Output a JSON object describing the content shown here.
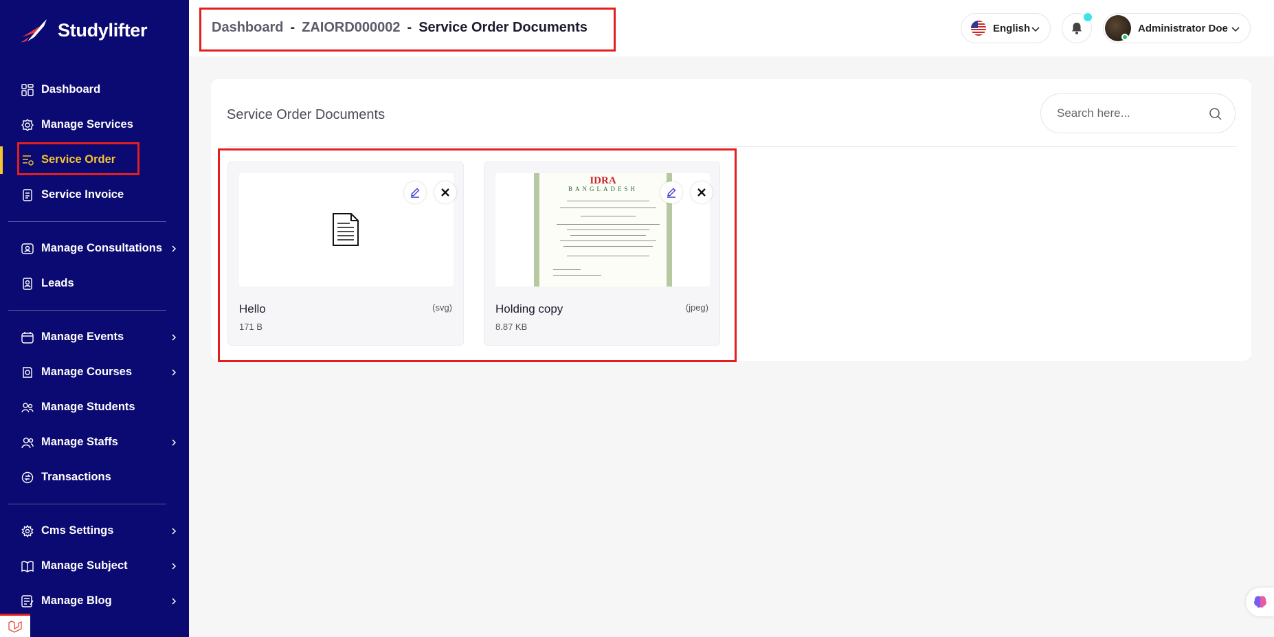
{
  "brand": {
    "name": "Studylifter"
  },
  "sidebar": {
    "groups": [
      [
        {
          "label": "Dashboard",
          "icon": "dashboard-icon",
          "chevron": false,
          "active": false
        },
        {
          "label": "Manage Services",
          "icon": "services-icon",
          "chevron": false,
          "active": false
        },
        {
          "label": "Service Order",
          "icon": "list-icon",
          "chevron": false,
          "active": true
        },
        {
          "label": "Service Invoice",
          "icon": "invoice-icon",
          "chevron": false,
          "active": false
        }
      ],
      [
        {
          "label": "Manage Consultations",
          "icon": "consultation-icon",
          "chevron": true,
          "active": false
        },
        {
          "label": "Leads",
          "icon": "leads-icon",
          "chevron": false,
          "active": false
        }
      ],
      [
        {
          "label": "Manage Events",
          "icon": "calendar-icon",
          "chevron": true,
          "active": false
        },
        {
          "label": "Manage Courses",
          "icon": "courses-icon",
          "chevron": true,
          "active": false
        },
        {
          "label": "Manage Students",
          "icon": "students-icon",
          "chevron": false,
          "active": false
        },
        {
          "label": "Manage Staffs",
          "icon": "staffs-icon",
          "chevron": true,
          "active": false
        },
        {
          "label": "Transactions",
          "icon": "transactions-icon",
          "chevron": false,
          "active": false
        }
      ],
      [
        {
          "label": "Cms Settings",
          "icon": "gear-icon",
          "chevron": true,
          "active": false
        },
        {
          "label": "Manage Subject",
          "icon": "book-icon",
          "chevron": true,
          "active": false
        },
        {
          "label": "Manage Blog",
          "icon": "blog-icon",
          "chevron": true,
          "active": false
        }
      ]
    ]
  },
  "header": {
    "breadcrumb": [
      "Dashboard",
      "ZAIORD000002",
      "Service Order Documents"
    ],
    "breadcrumb_separator": "-",
    "language": "English",
    "user_name": "Administrator Doe"
  },
  "main": {
    "title": "Service Order Documents",
    "search_placeholder": "Search here...",
    "documents": [
      {
        "name": "Hello",
        "ext": "(svg)",
        "size": "171 B",
        "preview": "file-icon"
      },
      {
        "name": "Holding copy",
        "ext": "(jpeg)",
        "size": "8.87 KB",
        "preview": "certificate-image",
        "preview_title": "IDRA",
        "preview_subtitle": "BANGLADESH"
      }
    ]
  },
  "colors": {
    "sidebar_bg": "#0b0a72",
    "active": "#f6c430",
    "highlight": "#e41d1d",
    "notification": "#3de3e8",
    "online": "#22c55e"
  }
}
